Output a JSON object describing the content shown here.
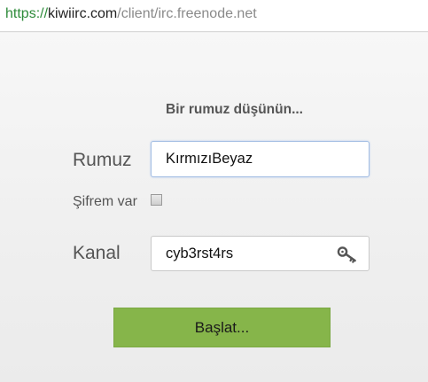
{
  "browser": {
    "url_scheme": "https://",
    "url_host": "kiwiirc.com",
    "url_path": "/client/irc.freenode.net"
  },
  "login": {
    "heading": "Bir rumuz düşünün...",
    "nick_label": "Rumuz",
    "nick_value": "KırmızıBeyaz",
    "password_label": "Şifrem var",
    "password_checked": false,
    "channel_label": "Kanal",
    "channel_value": "cyb3rst4rs",
    "channel_key_icon": "key-icon",
    "start_label": "Başlat...",
    "start_color": "#86b54a"
  }
}
